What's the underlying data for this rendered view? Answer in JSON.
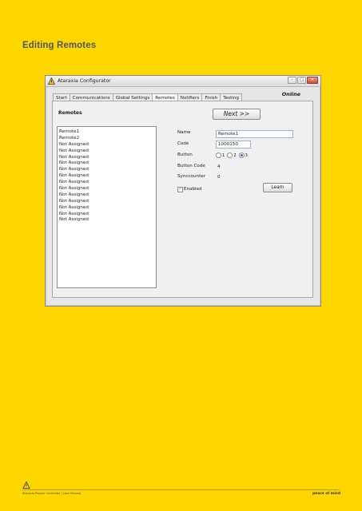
{
  "page": {
    "title": "Editing Remotes"
  },
  "window": {
    "title": "Ataraxia Configurator",
    "min": "–",
    "max": "□",
    "close": "✕"
  },
  "tabs": [
    {
      "label": "Start"
    },
    {
      "label": "Communications"
    },
    {
      "label": "Global Settings"
    },
    {
      "label": "Remotes",
      "active": true
    },
    {
      "label": "Notifiers"
    },
    {
      "label": "Finish"
    },
    {
      "label": "Testing"
    }
  ],
  "status": "Online",
  "next_button": "Next >>",
  "section_title": "Remotes",
  "remotes": [
    "Remote1",
    "Remote2",
    "Not Assigned",
    "Not Assigned",
    "Not Assigned",
    "Not Assigned",
    "Not Assigned",
    "Not Assigned",
    "Not Assigned",
    "Not Assigned",
    "Not Assigned",
    "Not Assigned",
    "Not Assigned",
    "Not Assigned",
    "Not Assigned"
  ],
  "form": {
    "name_label": "Name",
    "name_value": "Remote1",
    "code_label": "Code",
    "code_value": "1000150",
    "button_label": "Button",
    "button_options": [
      "1",
      "2",
      "3"
    ],
    "button_selected": "3",
    "button_code_label": "Button Code",
    "button_code_value": "4",
    "synccounter_label": "Synccounter",
    "synccounter_value": "0",
    "enabled_label": "Enabled",
    "enabled": true,
    "learn_button": "Learn"
  },
  "footer": {
    "left": "Ataraxia Pepper Controller | User Manual",
    "right": "peace of mind"
  },
  "icons": {
    "app": "warning-triangle-icon",
    "footer_logo": "warning-triangle-icon"
  },
  "colors": {
    "background": "#FFD700",
    "accent": "#3c6fb5"
  }
}
